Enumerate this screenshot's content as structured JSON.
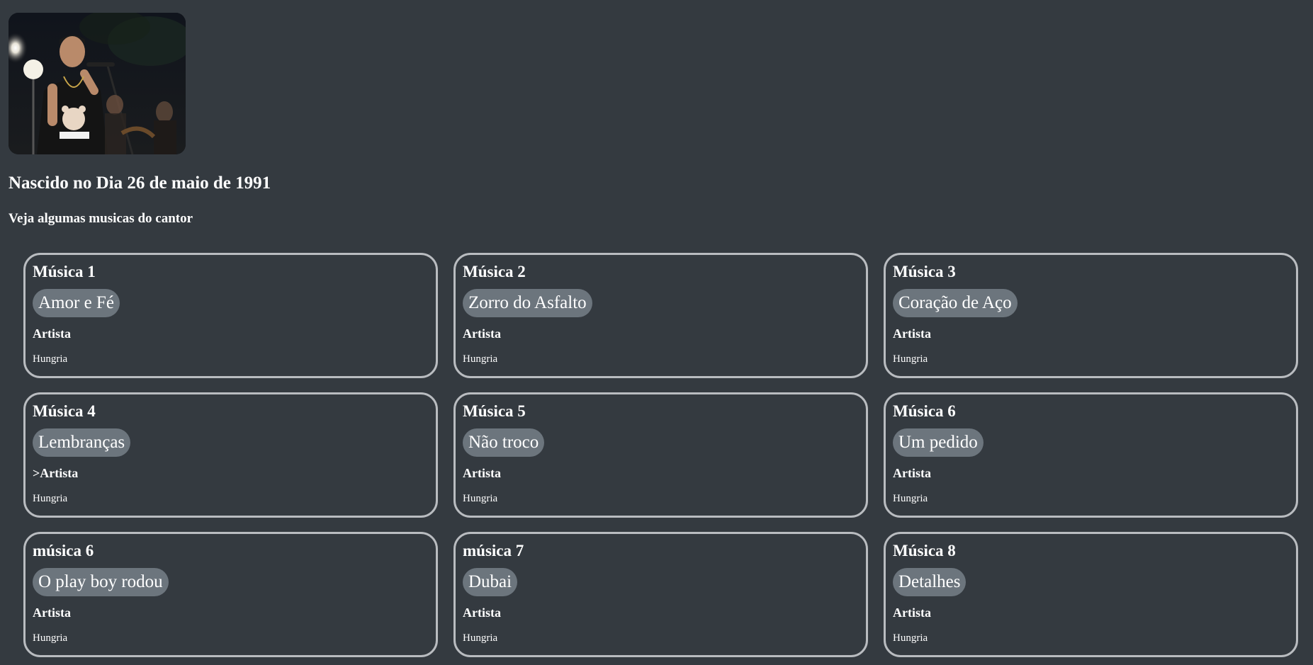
{
  "header": {
    "birth": "Nascido no Dia 26 de maio de 1991",
    "intro": "Veja algumas musicas do cantor"
  },
  "songs": [
    {
      "heading": "Música 1",
      "title": "Amor e Fé",
      "artist_label": "Artista",
      "artist": "Hungria"
    },
    {
      "heading": "Música 2",
      "title": "Zorro do Asfalto",
      "artist_label": "Artista",
      "artist": "Hungria"
    },
    {
      "heading": "Música 3",
      "title": "Coração de Aço",
      "artist_label": "Artista",
      "artist": "Hungria"
    },
    {
      "heading": "Música 4",
      "title": "Lembranças",
      "artist_label": ">Artista",
      "artist": "Hungria"
    },
    {
      "heading": "Música 5",
      "title": "Não troco",
      "artist_label": "Artista",
      "artist": "Hungria"
    },
    {
      "heading": "Música 6",
      "title": "Um pedido",
      "artist_label": "Artista",
      "artist": "Hungria"
    },
    {
      "heading": "música 6",
      "title": "O play boy rodou",
      "artist_label": "Artista",
      "artist": "Hungria"
    },
    {
      "heading": "música 7",
      "title": "Dubai",
      "artist_label": "Artista",
      "artist": "Hungria"
    },
    {
      "heading": "Música 8",
      "title": "Detalhes",
      "artist_label": "Artista",
      "artist": "Hungria"
    }
  ],
  "colors": {
    "background": "#343a40",
    "pill": "#6c757d",
    "card_border": "#b9bcc0",
    "text": "#ffffff"
  }
}
